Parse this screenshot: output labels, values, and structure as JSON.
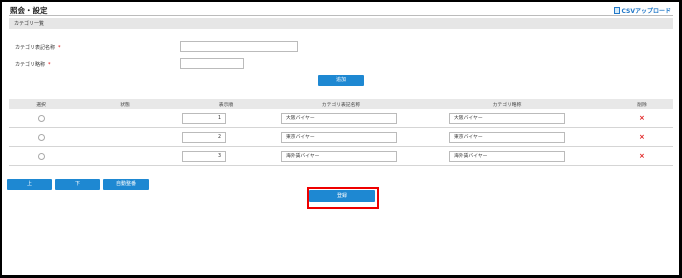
{
  "header": {
    "title": "照会・設定",
    "csv_upload_label": "CSVアップロード"
  },
  "section": {
    "title": "カテゴリ一覧"
  },
  "form": {
    "display_name_label": "カテゴリ表記名称",
    "short_name_label": "カテゴリ略称",
    "required_mark": "*",
    "add_button": "追加"
  },
  "table": {
    "headers": [
      "選択",
      "状態",
      "表示順",
      "カテゴリ表記名称",
      "カテゴリ略称",
      "削除"
    ],
    "rows": [
      {
        "order": "1",
        "display_name": "大阪バイヤー",
        "short_name": "大阪バイヤー",
        "delete": "×"
      },
      {
        "order": "2",
        "display_name": "東京バイヤー",
        "short_name": "東京バイヤー",
        "delete": "×"
      },
      {
        "order": "3",
        "display_name": "海外賃バイヤー",
        "short_name": "海外賃バイヤー",
        "delete": "×"
      }
    ]
  },
  "actions": {
    "up_button": "上",
    "down_button": "下",
    "auto_sort_button": "自動整番",
    "register_button": "登録"
  }
}
